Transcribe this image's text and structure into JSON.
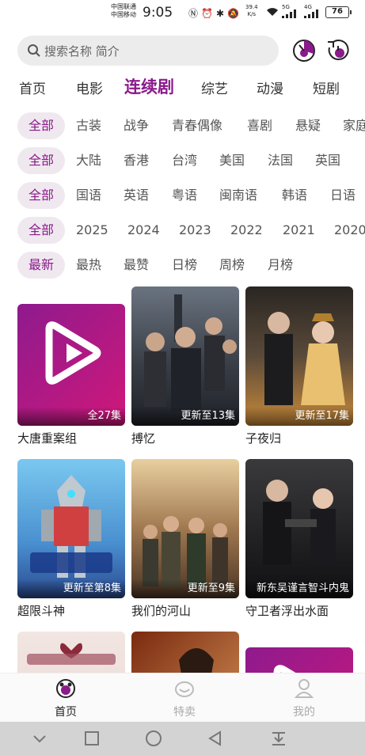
{
  "status_bar": {
    "carrier_1": "中国联通",
    "carrier_2": "中国移动",
    "time": "9:05",
    "net_speed_value": "39.4",
    "net_speed_unit": "K/s",
    "sig_5g": "5G",
    "sig_4g": "4G",
    "battery": "76"
  },
  "search": {
    "placeholder": "搜索名称 简介"
  },
  "categories": [
    "首页",
    "电影",
    "连续剧",
    "综艺",
    "动漫",
    "短剧"
  ],
  "active_category": "连续剧",
  "filters": {
    "genre": [
      "全部",
      "古装",
      "战争",
      "青春偶像",
      "喜剧",
      "悬疑",
      "家庭"
    ],
    "region": [
      "全部",
      "大陆",
      "香港",
      "台湾",
      "美国",
      "法国",
      "英国"
    ],
    "language": [
      "全部",
      "国语",
      "英语",
      "粤语",
      "闽南语",
      "韩语",
      "日语"
    ],
    "year": [
      "全部",
      "2025",
      "2024",
      "2023",
      "2022",
      "2021",
      "2020"
    ],
    "sort": [
      "最新",
      "最热",
      "最赞",
      "日榜",
      "周榜",
      "月榜"
    ]
  },
  "shows": [
    {
      "title": "大唐重案组",
      "badge": "全27集"
    },
    {
      "title": "搏忆",
      "badge": "更新至13集"
    },
    {
      "title": "子夜归",
      "badge": "更新至17集"
    },
    {
      "title": "超限斗神",
      "badge": "更新至第8集"
    },
    {
      "title": "我们的河山",
      "badge": "更新至9集"
    },
    {
      "title": "守卫者浮出水面",
      "badge": "新东吴谨言智斗内鬼"
    },
    {
      "title": "",
      "badge": ""
    },
    {
      "title": "",
      "badge": ""
    },
    {
      "title": "",
      "badge": ""
    }
  ],
  "bottom_nav": [
    "首页",
    "特卖",
    "我的"
  ],
  "colors": {
    "accent": "#8b1a8b",
    "chip_bg": "#efe9ef",
    "search_bg": "#ececec"
  }
}
